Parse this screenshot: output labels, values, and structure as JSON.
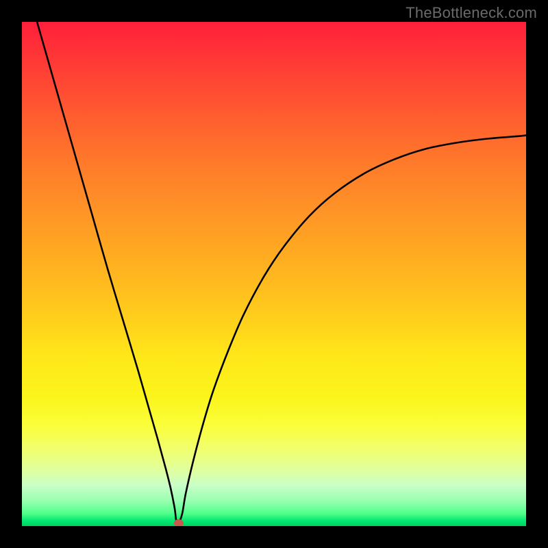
{
  "attribution": "TheBottleneck.com",
  "chart_data": {
    "type": "line",
    "title": "",
    "xlabel": "",
    "ylabel": "",
    "xlim": [
      0,
      100
    ],
    "ylim": [
      0,
      100
    ],
    "background_gradient": {
      "top_color": "#ff1f3a",
      "mid_color": "#ffe61a",
      "bottom_color": "#00d060"
    },
    "series": [
      {
        "name": "bottleneck-curve",
        "color": "#000000",
        "x": [
          3,
          5,
          8,
          11,
          14,
          17,
          20,
          23,
          25,
          27,
          28.5,
          29.5,
          30.3,
          30.6,
          31.1,
          31.8,
          32.5,
          34,
          36,
          38,
          41,
          44,
          48,
          52,
          57,
          62,
          68,
          74,
          80,
          86,
          92,
          98,
          100
        ],
        "y": [
          100,
          93,
          82.5,
          72,
          61.5,
          51,
          41,
          31,
          24,
          17,
          11.5,
          7.5,
          3.5,
          1.2,
          0.7,
          2.5,
          6.5,
          13,
          20.5,
          27,
          35,
          42,
          49.5,
          55.5,
          61.5,
          66,
          70,
          72.8,
          74.8,
          76,
          76.8,
          77.3,
          77.5
        ]
      }
    ],
    "marker": {
      "name": "optimal-point",
      "x": 31.1,
      "y": 0.6,
      "color": "#c75a4a"
    }
  }
}
